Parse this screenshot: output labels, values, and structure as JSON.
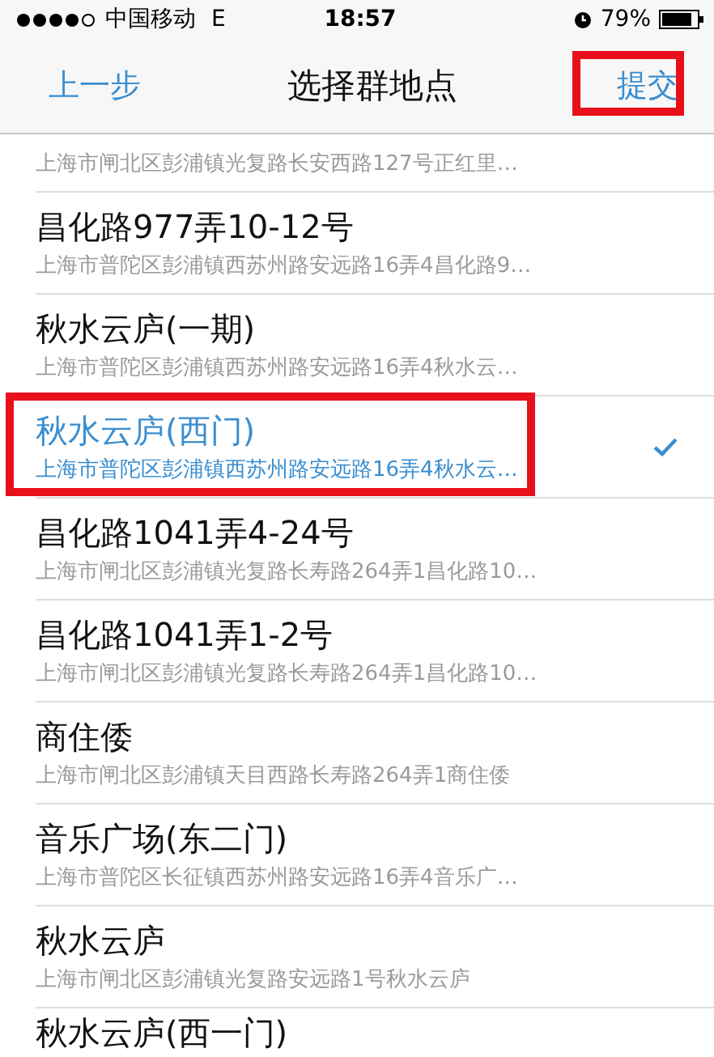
{
  "status_bar": {
    "carrier": "中国移动",
    "network": "E",
    "time": "18:57",
    "battery": "79%"
  },
  "nav_bar": {
    "back": "上一步",
    "title": "选择群地点",
    "action": "提交"
  },
  "rows": [
    {
      "kind": "partial",
      "subtitle": "上海市闸北区彭浦镇光复路长安西路127号正红里…",
      "selected": false
    },
    {
      "kind": "full",
      "title": "昌化路977弄10-12号",
      "subtitle": "上海市普陀区彭浦镇西苏州路安远路16弄4昌化路9…",
      "selected": false
    },
    {
      "kind": "full",
      "title": "秋水云庐(一期)",
      "subtitle": "上海市普陀区彭浦镇西苏州路安远路16弄4秋水云…",
      "selected": false
    },
    {
      "kind": "full",
      "title": "秋水云庐(西门)",
      "subtitle": "上海市普陀区彭浦镇西苏州路安远路16弄4秋水云…",
      "selected": true
    },
    {
      "kind": "full",
      "title": "昌化路1041弄4-24号",
      "subtitle": "上海市闸北区彭浦镇光复路长寿路264弄1昌化路10…",
      "selected": false
    },
    {
      "kind": "full",
      "title": "昌化路1041弄1-2号",
      "subtitle": "上海市闸北区彭浦镇光复路长寿路264弄1昌化路10…",
      "selected": false
    },
    {
      "kind": "full",
      "title": "商住倭",
      "subtitle": "上海市闸北区彭浦镇天目西路长寿路264弄1商住倭",
      "selected": false
    },
    {
      "kind": "full",
      "title": "音乐广场(东二门)",
      "subtitle": "上海市普陀区长征镇西苏州路安远路16弄4音乐广…",
      "selected": false
    },
    {
      "kind": "full",
      "title": "秋水云庐",
      "subtitle": "上海市闸北区彭浦镇光复路安远路1号秋水云庐",
      "selected": false
    },
    {
      "kind": "cut",
      "title": "秋水云庐(西一门)",
      "selected": false
    }
  ]
}
